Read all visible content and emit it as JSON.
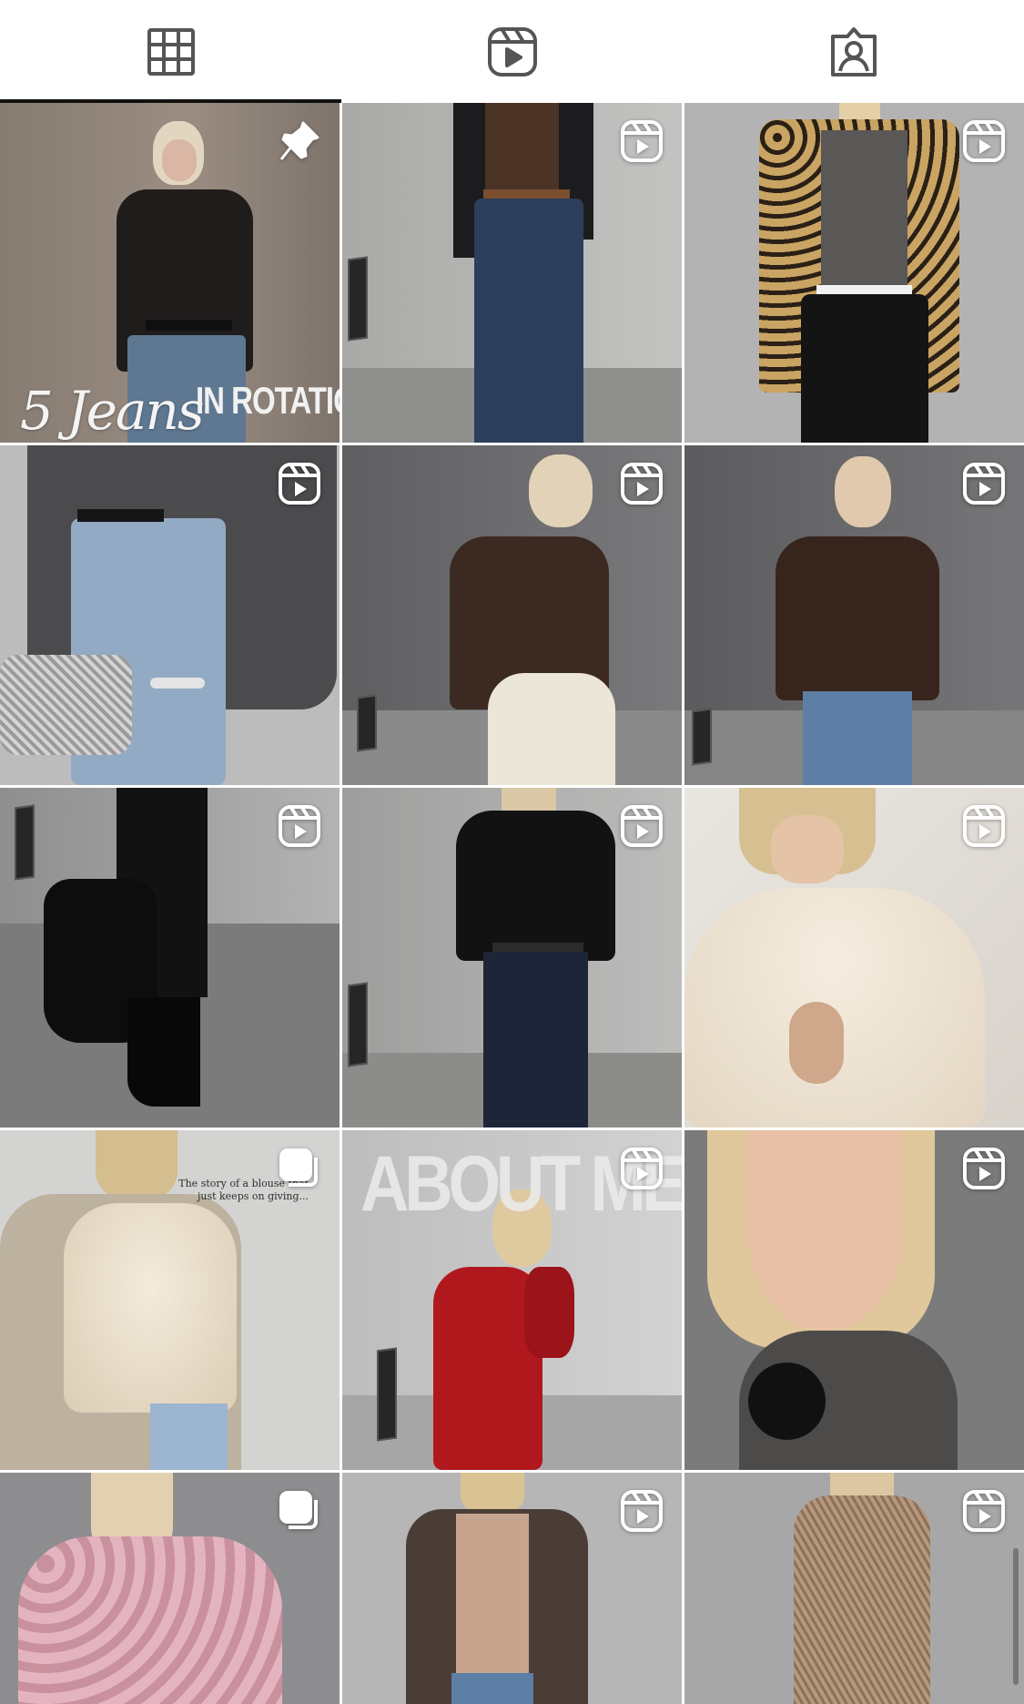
{
  "tabs": [
    {
      "name": "posts",
      "icon": "grid-icon",
      "selected": true
    },
    {
      "name": "reels",
      "icon": "reels-icon",
      "selected": false
    },
    {
      "name": "tagged",
      "icon": "tagged-user-icon",
      "selected": false
    }
  ],
  "posts": [
    {
      "type": "pinned",
      "badge": "pin-icon",
      "cover_text": {
        "script": "5 Jeans",
        "block": "IN ROTATION"
      }
    },
    {
      "type": "reel",
      "badge": "reel-icon"
    },
    {
      "type": "reel",
      "badge": "reel-icon"
    },
    {
      "type": "reel",
      "badge": "reel-icon"
    },
    {
      "type": "reel",
      "badge": "reel-icon"
    },
    {
      "type": "reel",
      "badge": "reel-icon"
    },
    {
      "type": "reel",
      "badge": "reel-icon"
    },
    {
      "type": "reel",
      "badge": "reel-icon"
    },
    {
      "type": "reel",
      "badge": "reel-icon"
    },
    {
      "type": "carousel",
      "badge": "carousel-icon",
      "caption": "The story of a blouse that just keeps on giving..."
    },
    {
      "type": "reel",
      "badge": "reel-icon",
      "cover_text": {
        "big": "ABOUT ME"
      }
    },
    {
      "type": "reel",
      "badge": "reel-icon"
    },
    {
      "type": "carousel",
      "badge": "carousel-icon"
    },
    {
      "type": "reel",
      "badge": "reel-icon"
    },
    {
      "type": "reel",
      "badge": "reel-icon"
    }
  ],
  "colors": {
    "tab_icon": "#555555",
    "tab_indicator": "#111111",
    "badge": "#ffffff"
  }
}
